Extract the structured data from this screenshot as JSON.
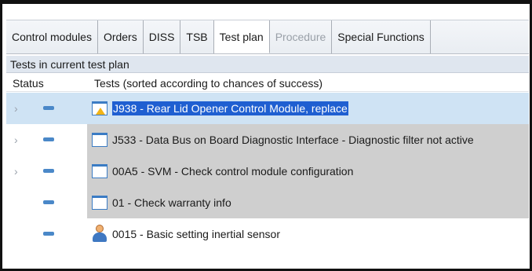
{
  "tabs": [
    {
      "label": "Control modules",
      "state": "normal"
    },
    {
      "label": "Orders",
      "state": "normal"
    },
    {
      "label": "DISS",
      "state": "normal"
    },
    {
      "label": "TSB",
      "state": "normal"
    },
    {
      "label": "Test plan",
      "state": "active"
    },
    {
      "label": "Procedure",
      "state": "disabled"
    },
    {
      "label": "Special Functions",
      "state": "normal"
    }
  ],
  "section_title": "Tests in current test plan",
  "columns": {
    "status": "Status",
    "tests": "Tests (sorted according to chances of success)"
  },
  "rows": [
    {
      "label": "J938 - Rear Lid Opener Control Module, replace",
      "icon": "warning-doc-icon",
      "expandable": true,
      "selected": true
    },
    {
      "label": "J533 - Data Bus on Board Diagnostic Interface  - Diagnostic filter not active",
      "icon": "document-icon",
      "expandable": true,
      "selected": false
    },
    {
      "label": "00A5 - SVM - Check control module configuration",
      "icon": "document-icon",
      "expandable": true,
      "selected": false
    },
    {
      "label": "01 - Check warranty info",
      "icon": "document-icon",
      "expandable": false,
      "selected": false
    },
    {
      "label": "0015 - Basic setting inertial sensor",
      "icon": "person-icon",
      "expandable": false,
      "selected": false
    }
  ],
  "colors": {
    "selection_row": "#cfe3f4",
    "selection_text": "#1f5fd1",
    "gray_row": "#cfcfcf",
    "status_dash": "#4a88c8"
  }
}
